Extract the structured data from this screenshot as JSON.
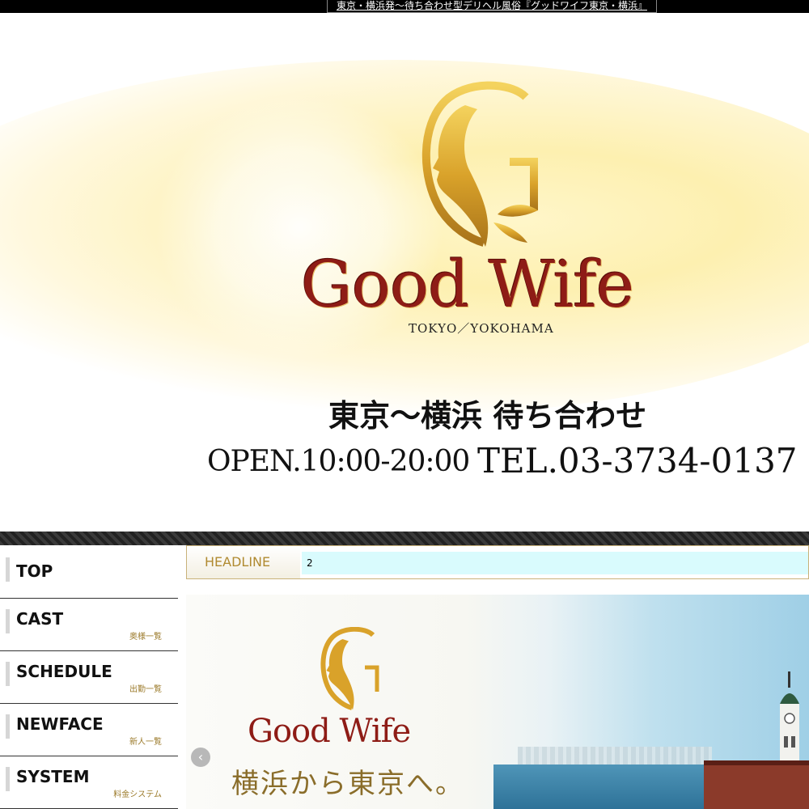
{
  "topbar": {
    "tagline": "東京・横浜発〜待ち合わせ型デリヘル風俗『グッドワイフ東京・横浜』"
  },
  "header": {
    "brand": "Good Wife",
    "brand_sub": "TOKYO／YOKOHAMA",
    "catch": "東京〜横浜 待ち合わせ",
    "hours": "OPEN.10:00-20:00",
    "tel": "TEL.03-3734-0137"
  },
  "nav": {
    "items": [
      {
        "label": "TOP",
        "sub": ""
      },
      {
        "label": "CAST",
        "sub": "奥様一覧"
      },
      {
        "label": "SCHEDULE",
        "sub": "出勤一覧"
      },
      {
        "label": "NEWFACE",
        "sub": "新人一覧"
      },
      {
        "label": "SYSTEM",
        "sub": "料金システム"
      }
    ]
  },
  "headline": {
    "label": "HEADLINE",
    "ticker": "2"
  },
  "banner": {
    "brand": "Good Wife",
    "catch": "横浜から東京へ。",
    "prev_icon": "chevron-left-icon"
  },
  "colors": {
    "brand_red": "#8e1c16",
    "gold": "#c9a23a",
    "headline_label": "#b08a30",
    "ticker_bg": "#d9fbfd"
  }
}
